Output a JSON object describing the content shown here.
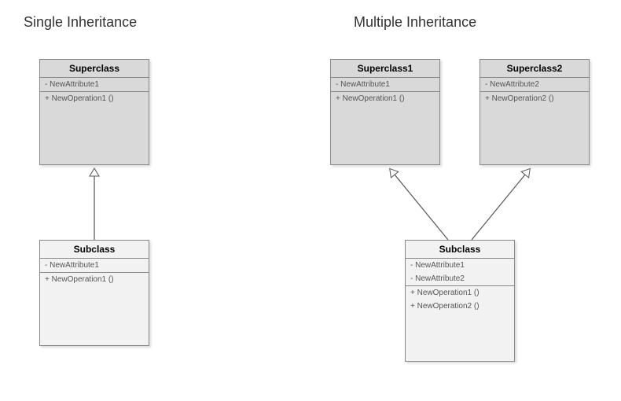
{
  "titles": {
    "single": "Single Inheritance",
    "multiple": "Multiple Inheritance"
  },
  "single": {
    "super": {
      "name": "Superclass",
      "attrs": [
        "- NewAttribute1"
      ],
      "ops": [
        "+ NewOperation1 ()"
      ]
    },
    "sub": {
      "name": "Subclass",
      "attrs": [
        "- NewAttribute1"
      ],
      "ops": [
        "+ NewOperation1 ()"
      ]
    }
  },
  "multiple": {
    "super1": {
      "name": "Superclass1",
      "attrs": [
        "- NewAttribute1"
      ],
      "ops": [
        "+ NewOperation1 ()"
      ]
    },
    "super2": {
      "name": "Superclass2",
      "attrs": [
        "- NewAttribute2"
      ],
      "ops": [
        "+ NewOperation2 ()"
      ]
    },
    "sub": {
      "name": "Subclass",
      "attrs": [
        "- NewAttribute1",
        "- NewAttribute2"
      ],
      "ops": [
        "+ NewOperation1 ()",
        "+ NewOperation2 ()"
      ]
    }
  }
}
